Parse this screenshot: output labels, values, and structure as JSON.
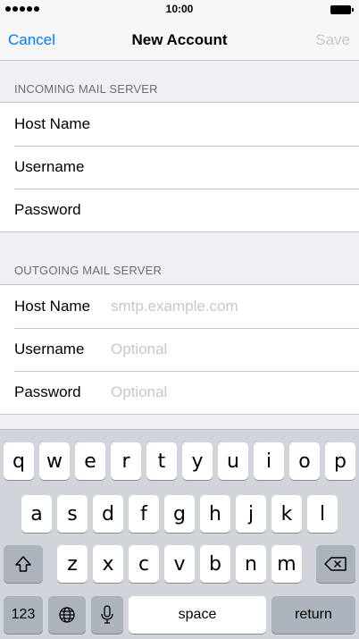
{
  "status_bar": {
    "time": "10:00"
  },
  "nav": {
    "cancel": "Cancel",
    "title": "New Account",
    "save": "Save",
    "accent_color": "#007aff",
    "disabled_color": "#c7c7cc"
  },
  "incoming": {
    "header": "INCOMING MAIL SERVER",
    "rows": [
      {
        "label": "Host Name",
        "placeholder": ""
      },
      {
        "label": "Username",
        "placeholder": ""
      },
      {
        "label": "Password",
        "placeholder": ""
      }
    ]
  },
  "outgoing": {
    "header": "OUTGOING MAIL SERVER",
    "rows": [
      {
        "label": "Host Name",
        "placeholder": "smtp.example.com"
      },
      {
        "label": "Username",
        "placeholder": "Optional"
      },
      {
        "label": "Password",
        "placeholder": "Optional"
      }
    ]
  },
  "keyboard": {
    "row1": [
      "q",
      "w",
      "e",
      "r",
      "t",
      "y",
      "u",
      "i",
      "o",
      "p"
    ],
    "row2": [
      "a",
      "s",
      "d",
      "f",
      "g",
      "h",
      "j",
      "k",
      "l"
    ],
    "row3": [
      "z",
      "x",
      "c",
      "v",
      "b",
      "n",
      "m"
    ],
    "numbers_key": "123",
    "space_key": "space",
    "return_key": "return",
    "icons": {
      "shift": "shift-icon",
      "delete": "delete-icon",
      "globe": "globe-icon",
      "mic": "microphone-icon"
    }
  }
}
